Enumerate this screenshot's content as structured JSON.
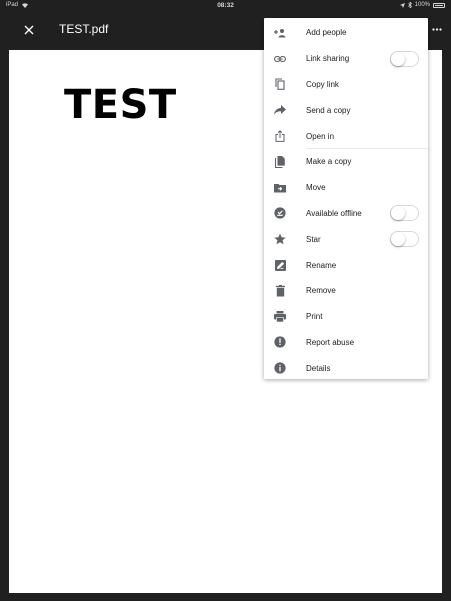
{
  "status_bar": {
    "carrier": "iPad",
    "time": "08:32",
    "battery": "100%"
  },
  "app_bar": {
    "title": "TEST.pdf"
  },
  "document": {
    "text": "TEST"
  },
  "menu": {
    "items": [
      {
        "label": "Add people",
        "icon": "add-person-icon"
      },
      {
        "label": "Link sharing",
        "icon": "link-icon",
        "toggle": false
      },
      {
        "label": "Copy link",
        "icon": "copy-icon"
      },
      {
        "label": "Send a copy",
        "icon": "share-arrow-icon"
      },
      {
        "label": "Open in",
        "icon": "open-in-icon"
      },
      {
        "label": "Make a copy",
        "icon": "file-copy-icon"
      },
      {
        "label": "Move",
        "icon": "move-folder-icon"
      },
      {
        "label": "Available offline",
        "icon": "offline-check-icon",
        "toggle": false
      },
      {
        "label": "Star",
        "icon": "star-icon",
        "toggle": false
      },
      {
        "label": "Rename",
        "icon": "rename-icon"
      },
      {
        "label": "Remove",
        "icon": "trash-icon"
      },
      {
        "label": "Print",
        "icon": "printer-icon"
      },
      {
        "label": "Report abuse",
        "icon": "report-icon"
      },
      {
        "label": "Details",
        "icon": "info-icon"
      }
    ]
  }
}
